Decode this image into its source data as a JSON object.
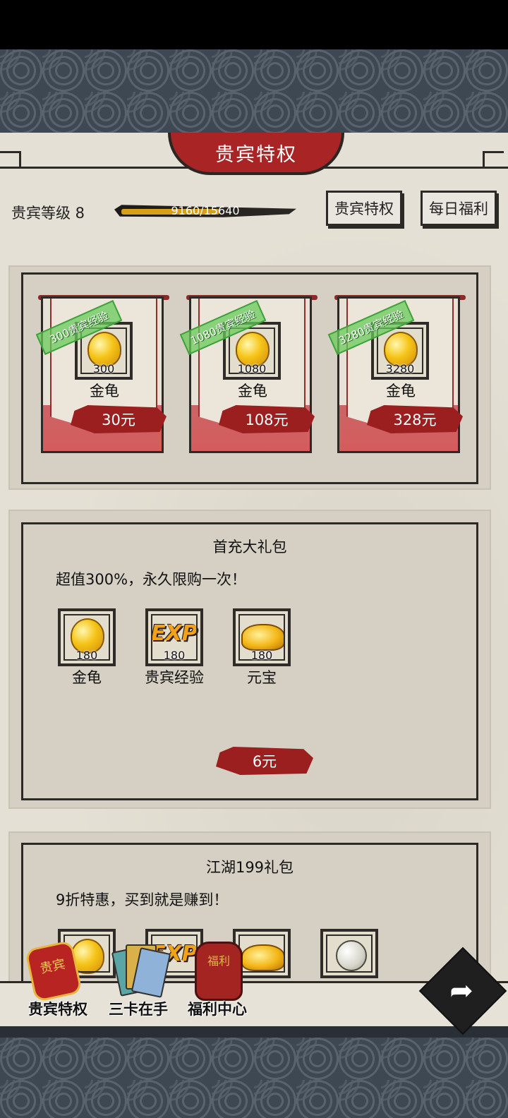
{
  "header": {
    "title": "贵宾特权"
  },
  "vip": {
    "level_label": "贵宾等级 8",
    "progress_text": "9160/15640",
    "progress_fraction": 0.586,
    "btn_privilege": "贵宾特权",
    "btn_daily": "每日福利"
  },
  "recharge_packs": [
    {
      "stamp": "300贵宾经验",
      "count": "300",
      "name": "金龟",
      "price": "30元"
    },
    {
      "stamp": "1080贵宾经验",
      "count": "1080",
      "name": "金龟",
      "price": "108元"
    },
    {
      "stamp": "3280贵宾经验",
      "count": "3280",
      "name": "金龟",
      "price": "328元"
    }
  ],
  "first_pack": {
    "title": "首充大礼包",
    "desc": "超值300%，永久限购一次！",
    "items": [
      {
        "count": "180",
        "name": "金龟",
        "icon": "gold-turtle-icon"
      },
      {
        "count": "180",
        "name": "贵宾经验",
        "icon": "exp-icon"
      },
      {
        "count": "180",
        "name": "元宝",
        "icon": "gold-ingot-icon"
      }
    ],
    "price": "6元",
    "exp_glyph": "EXP"
  },
  "jianghu_pack": {
    "title": "江湖199礼包",
    "desc": "9折特惠，买到就是赚到！"
  },
  "nav": {
    "vip": "贵宾特权",
    "vip_badge": "贵宾",
    "cards": "三卡在手",
    "welfare": "福利中心",
    "welfare_badge": "福利"
  },
  "share_glyph": "➦",
  "colors": {
    "accent_red": "#a82425",
    "gold": "#d6a019",
    "stamp_green": "#68c95a"
  }
}
